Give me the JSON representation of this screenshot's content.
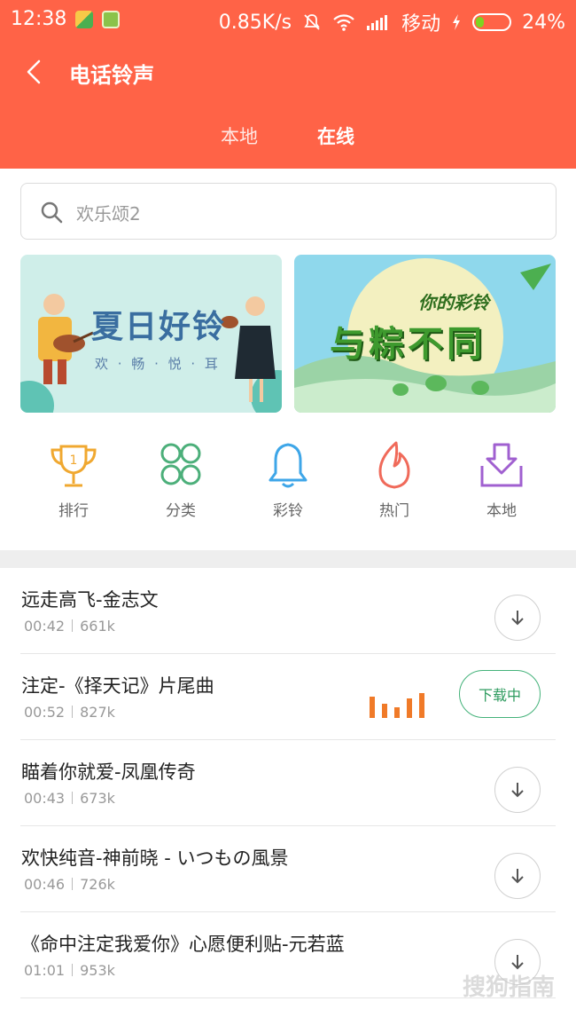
{
  "status_bar": {
    "time": "12:38",
    "speed": "0.85K/s",
    "carrier": "移动",
    "battery": "24%",
    "battery_level": 0.24
  },
  "nav": {
    "title": "电话铃声"
  },
  "tabs": [
    {
      "label": "本地",
      "active": false
    },
    {
      "label": "在线",
      "active": true
    }
  ],
  "search": {
    "placeholder": "欢乐颂2"
  },
  "banners": [
    {
      "title": "夏日好铃",
      "subtitle": "欢 · 畅 · 悦 · 耳"
    },
    {
      "title": "与粽不同",
      "tag": "你的彩铃"
    }
  ],
  "quick_links": [
    {
      "label": "排行",
      "icon": "trophy-icon",
      "color": "#f0a830"
    },
    {
      "label": "分类",
      "icon": "grid-circles-icon",
      "color": "#4caf7a"
    },
    {
      "label": "彩铃",
      "icon": "bell-icon",
      "color": "#3ea6e8"
    },
    {
      "label": "热门",
      "icon": "flame-icon",
      "color": "#f06a5a"
    },
    {
      "label": "本地",
      "icon": "download-tray-icon",
      "color": "#a060d0"
    }
  ],
  "songs": [
    {
      "title": "远走高飞-金志文",
      "duration": "00:42",
      "size": "661k",
      "state": "download"
    },
    {
      "title": "注定-《择天记》片尾曲",
      "duration": "00:52",
      "size": "827k",
      "state": "downloading",
      "state_label": "下载中"
    },
    {
      "title": "瞄着你就爱-凤凰传奇",
      "duration": "00:43",
      "size": "673k",
      "state": "download"
    },
    {
      "title": "欢快纯音-神前晓 - いつもの風景",
      "duration": "00:46",
      "size": "726k",
      "state": "download"
    },
    {
      "title": "《命中注定我爱你》心愿便利贴-元若蓝",
      "duration": "01:01",
      "size": "953k",
      "state": "download"
    }
  ],
  "colors": {
    "header": "#ff6347",
    "downloading": "#2e9b5f",
    "equalizer": "#f07a28"
  },
  "watermark": "搜狗指南"
}
